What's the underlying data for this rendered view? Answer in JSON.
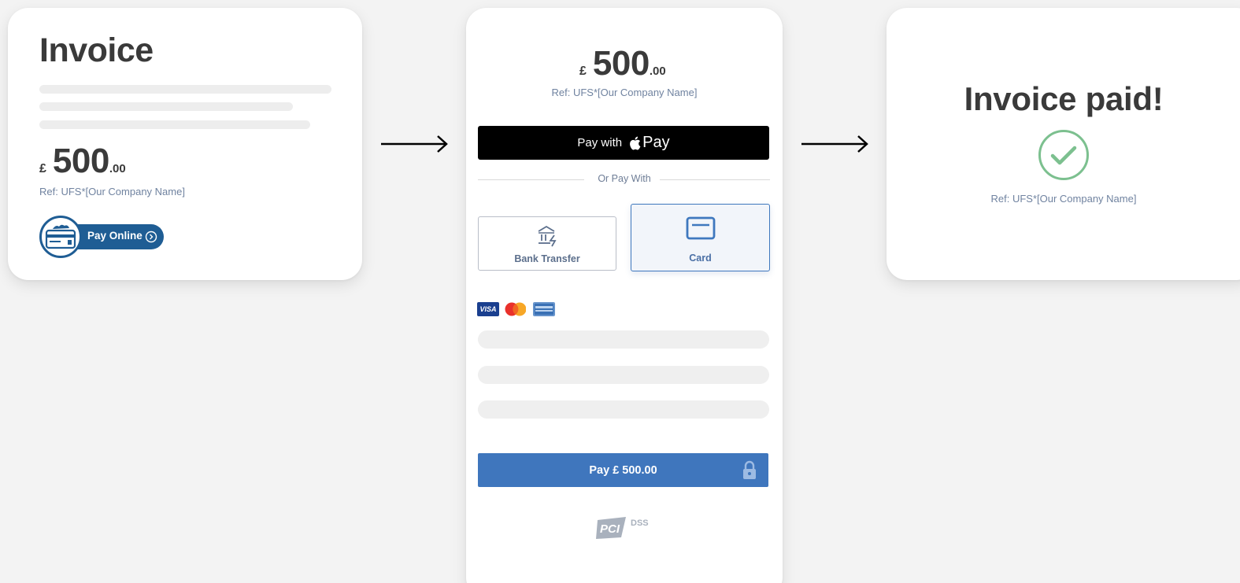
{
  "invoice_card": {
    "title": "Invoice",
    "currency": "£",
    "amount_whole": "500",
    "amount_cents": ".00",
    "ref": "Ref: UFS*[Our Company Name]",
    "pay_online_label": "Pay Online"
  },
  "payment_card": {
    "currency": "£",
    "amount_whole": "500",
    "amount_cents": ".00",
    "ref": "Ref: UFS*[Our Company Name]",
    "apple_pay_prefix": "Pay with",
    "apple_pay_brand": "Pay",
    "or_pay_with": "Or Pay With",
    "methods": [
      {
        "label": "Bank Transfer",
        "selected": false
      },
      {
        "label": "Card",
        "selected": true
      }
    ],
    "card_brands": [
      "VISA",
      "MasterCard",
      "American Express"
    ],
    "pay_button_label": "Pay £ 500.00",
    "pci_label": "DSS",
    "pci_mark": "PCI"
  },
  "paid_card": {
    "title": "Invoice paid!",
    "ref": "Ref: UFS*[Our Company Name]"
  },
  "colors": {
    "brand_blue": "#1f5d94",
    "primary_button": "#3f76bd",
    "success_green": "#7cc08f",
    "text_dark": "#3a3a3a",
    "text_muted": "#7083a0",
    "background": "#f3f3f3"
  }
}
